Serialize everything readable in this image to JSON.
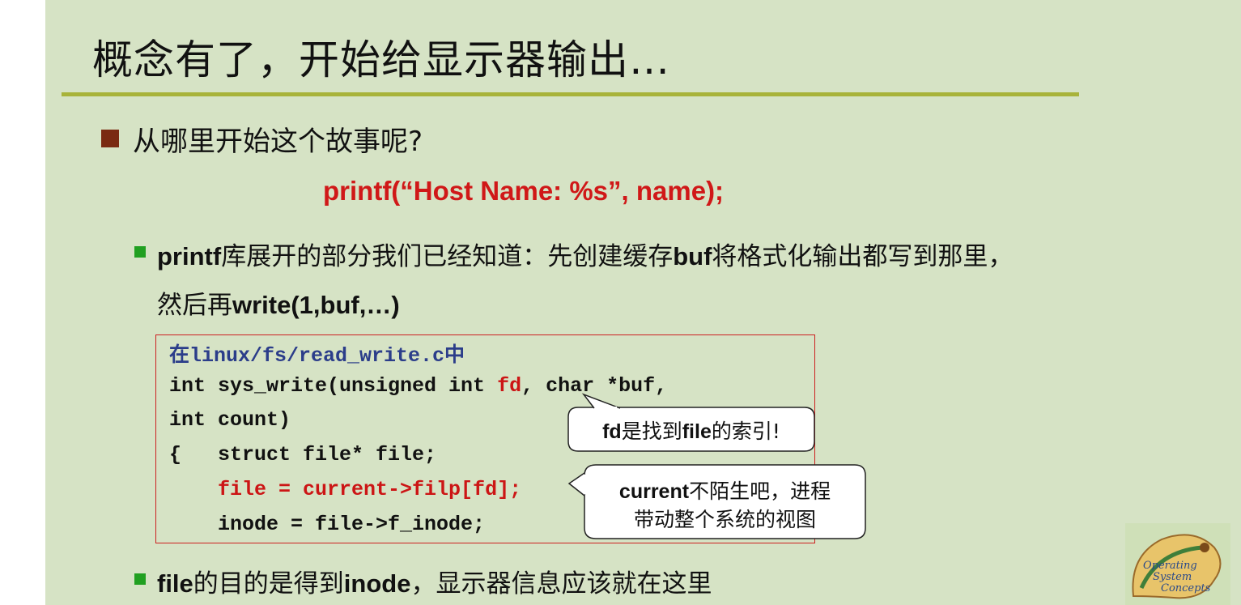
{
  "title": "概念有了，开始给显示器输出…",
  "bullet1": "从哪里开始这个故事呢?",
  "printf_line": "printf(“Host Name: %s”, name);",
  "sub1": {
    "p1": "printf",
    "t1": "库展开的部分我们已经知道：先创建缓存",
    "p2": "buf",
    "t2": "将格式化输出都写到那里，",
    "t3": "然后再",
    "p3": "write(1,buf,…)"
  },
  "code": {
    "header": "在linux/fs/read_write.c中",
    "line1_a": "int sys_write(unsigned int ",
    "line1_fd": "fd",
    "line1_b": ", char *buf,",
    "line2": "int count)",
    "line3": "{   struct file* file;",
    "line4": "    file = current->filp[fd];",
    "line5": "    inode = file->f_inode;"
  },
  "callout1": {
    "b": "fd",
    "t": "是找到",
    "b2": "file",
    "t2": "的索引!"
  },
  "callout2": {
    "b": "current",
    "t": "不陌生吧，进程",
    "line2": "带动整个系统的视图"
  },
  "sub2": {
    "p1": "file",
    "t1": "的目的是得到",
    "p2": "inode",
    "t2": "，显示器信息应该就在这里"
  },
  "logo": {
    "line1": "Operating",
    "line2": "System",
    "line3": "Concepts"
  },
  "colors": {
    "background": "#d6e3c5",
    "title_rule": "#a8b33a",
    "accent_red": "#d01818",
    "bullet_green": "#21a021",
    "bullet_brown": "#7a2a12"
  }
}
